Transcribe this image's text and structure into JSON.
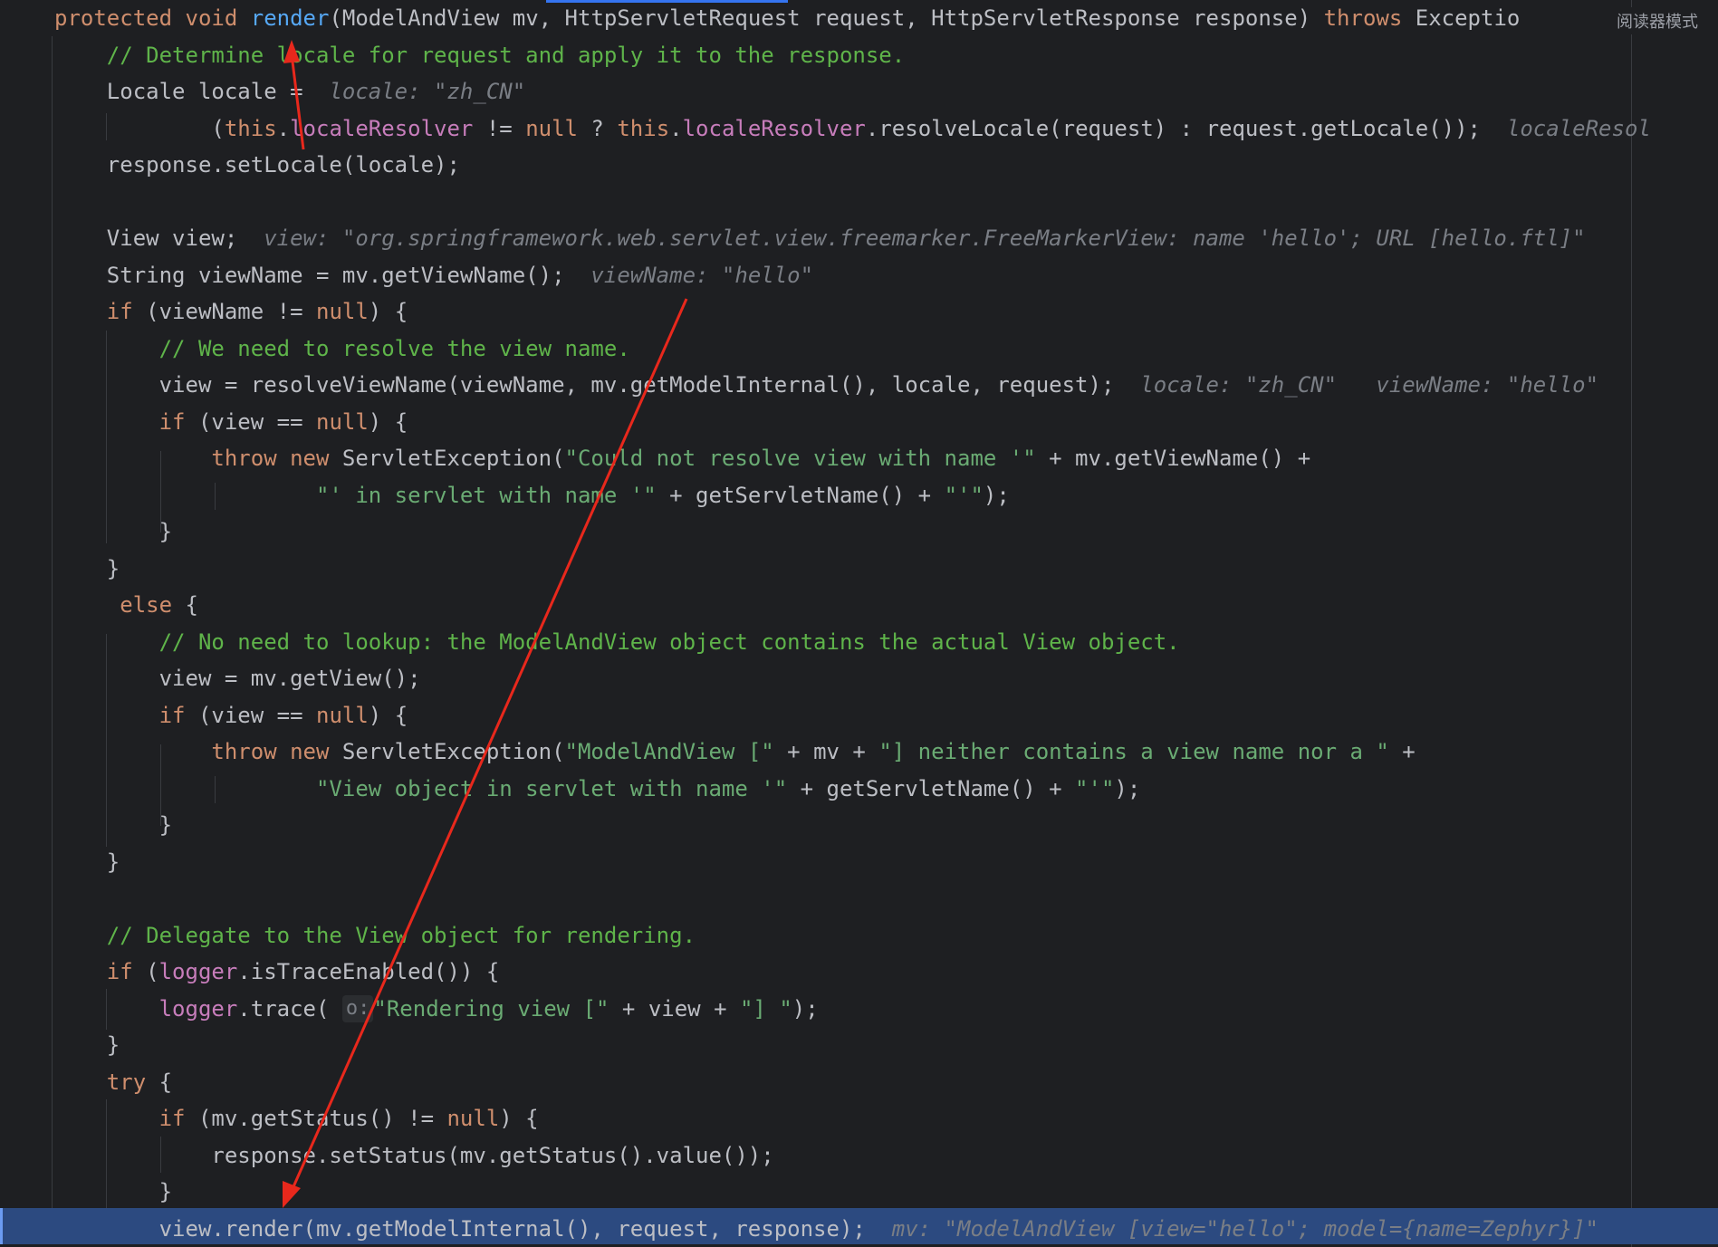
{
  "reader_mode_label": "阅读器模式",
  "lines": [
    [
      [
        "kw",
        "protected void "
      ],
      [
        "fn",
        "render"
      ],
      [
        "",
        "(ModelAndView mv, HttpServletRequest request, HttpServletResponse response) "
      ],
      [
        "kw",
        "throws"
      ],
      [
        "",
        " Exceptio"
      ]
    ],
    [
      [
        "",
        "    "
      ],
      [
        "cm",
        "// Determine locale for request and apply it to the response."
      ]
    ],
    [
      [
        "",
        "    Locale locale =  "
      ],
      [
        "hint",
        "locale: \"zh_CN\""
      ]
    ],
    [
      [
        "",
        "            ("
      ],
      [
        "kw",
        "this"
      ],
      [
        "",
        "."
      ],
      [
        "fld",
        "localeResolver"
      ],
      [
        "",
        " != "
      ],
      [
        "kw",
        "null"
      ],
      [
        "",
        " ? "
      ],
      [
        "kw",
        "this"
      ],
      [
        "",
        "."
      ],
      [
        "fld",
        "localeResolver"
      ],
      [
        "",
        ".resolveLocale(request) : request.getLocale());  "
      ],
      [
        "hint",
        "localeResol"
      ]
    ],
    [
      [
        "",
        "    response.setLocale(locale);"
      ]
    ],
    [
      [
        "",
        ""
      ]
    ],
    [
      [
        "",
        "    View view;  "
      ],
      [
        "hint",
        "view: \"org.springframework.web.servlet.view.freemarker.FreeMarkerView: name 'hello'; URL [hello.ftl]\""
      ]
    ],
    [
      [
        "",
        "    String viewName = mv.getViewName();  "
      ],
      [
        "hint",
        "viewName: \"hello\""
      ]
    ],
    [
      [
        "",
        "    "
      ],
      [
        "kw",
        "if"
      ],
      [
        "",
        " (viewName != "
      ],
      [
        "kw",
        "null"
      ],
      [
        "",
        ") {"
      ]
    ],
    [
      [
        "",
        "        "
      ],
      [
        "cm",
        "// We need to resolve the view name."
      ]
    ],
    [
      [
        "",
        "        view = resolveViewName(viewName, mv.getModelInternal(), locale, request);  "
      ],
      [
        "hint",
        "locale: \"zh_CN\"   viewName: \"hello\""
      ]
    ],
    [
      [
        "",
        "        "
      ],
      [
        "kw",
        "if"
      ],
      [
        "",
        " (view == "
      ],
      [
        "kw",
        "null"
      ],
      [
        "",
        ") {"
      ]
    ],
    [
      [
        "",
        "            "
      ],
      [
        "kw",
        "throw new"
      ],
      [
        "",
        " ServletException("
      ],
      [
        "st",
        "\"Could not resolve view with name '\""
      ],
      [
        "",
        " + mv.getViewName() +"
      ]
    ],
    [
      [
        "",
        "                    "
      ],
      [
        "st",
        "\"' in servlet with name '\""
      ],
      [
        "",
        " + getServletName() + "
      ],
      [
        "st",
        "\"'\""
      ],
      [
        "",
        ");"
      ]
    ],
    [
      [
        "",
        "        }"
      ]
    ],
    [
      [
        "",
        "    }"
      ]
    ],
    [
      [
        "",
        "     "
      ],
      [
        "kw",
        "else"
      ],
      [
        "",
        " {"
      ]
    ],
    [
      [
        "",
        "        "
      ],
      [
        "cm",
        "// No need to lookup: the ModelAndView object contains the actual View object."
      ]
    ],
    [
      [
        "",
        "        view = mv.getView();"
      ]
    ],
    [
      [
        "",
        "        "
      ],
      [
        "kw",
        "if"
      ],
      [
        "",
        " (view == "
      ],
      [
        "kw",
        "null"
      ],
      [
        "",
        ") {"
      ]
    ],
    [
      [
        "",
        "            "
      ],
      [
        "kw",
        "throw new"
      ],
      [
        "",
        " ServletException("
      ],
      [
        "st",
        "\"ModelAndView [\""
      ],
      [
        "",
        " + mv + "
      ],
      [
        "st",
        "\"] neither contains a view name nor a \""
      ],
      [
        "",
        " +"
      ]
    ],
    [
      [
        "",
        "                    "
      ],
      [
        "st",
        "\"View object in servlet with name '\""
      ],
      [
        "",
        " + getServletName() + "
      ],
      [
        "st",
        "\"'\""
      ],
      [
        "",
        ");"
      ]
    ],
    [
      [
        "",
        "        }"
      ]
    ],
    [
      [
        "",
        "    }"
      ]
    ],
    [
      [
        "",
        ""
      ]
    ],
    [
      [
        "",
        "    "
      ],
      [
        "cm",
        "// Delegate to the View object for rendering."
      ]
    ],
    [
      [
        "",
        "    "
      ],
      [
        "kw",
        "if"
      ],
      [
        "",
        " ("
      ],
      [
        "fld",
        "logger"
      ],
      [
        "",
        ".isTraceEnabled()) {"
      ]
    ],
    [
      [
        "",
        "        "
      ],
      [
        "fld",
        "logger"
      ],
      [
        "",
        ".trace( "
      ],
      [
        "chip",
        "o:"
      ],
      [
        "st",
        "\"Rendering view [\""
      ],
      [
        "",
        " + view + "
      ],
      [
        "st",
        "\"] \""
      ],
      [
        "",
        ");"
      ]
    ],
    [
      [
        "",
        "    }"
      ]
    ],
    [
      [
        "",
        "    "
      ],
      [
        "kw",
        "try"
      ],
      [
        "",
        " {"
      ]
    ],
    [
      [
        "",
        "        "
      ],
      [
        "kw",
        "if"
      ],
      [
        "",
        " (mv.getStatus() != "
      ],
      [
        "kw",
        "null"
      ],
      [
        "",
        ") {"
      ]
    ],
    [
      [
        "",
        "            response.setStatus(mv.getStatus().value());"
      ]
    ],
    [
      [
        "",
        "        }"
      ]
    ],
    [
      [
        "",
        "        view.render(mv.getModelInternal(), request, response);  "
      ],
      [
        "hint",
        "mv: \"ModelAndView [view=\"hello\"; model={name=Zephyr}]\""
      ]
    ]
  ]
}
